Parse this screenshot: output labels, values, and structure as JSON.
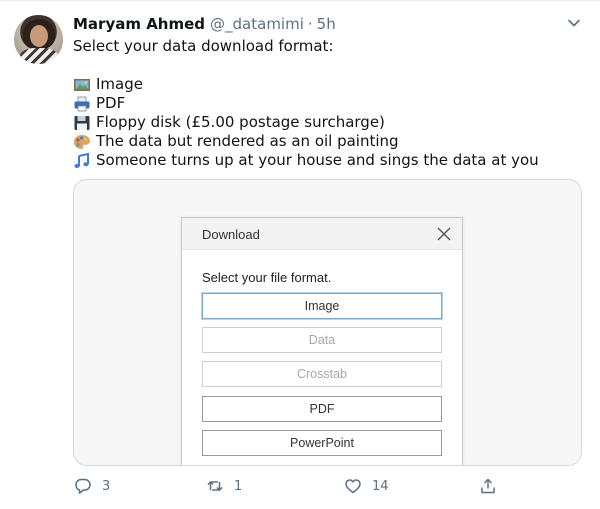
{
  "tweet": {
    "author_name": "Maryam Ahmed",
    "author_handle": "@_datamimi",
    "separator": "·",
    "timestamp": "5h",
    "lines": [
      {
        "text": "Select your data download format:",
        "icon": ""
      },
      {
        "text": "Image",
        "icon": "picture-emoji"
      },
      {
        "text": "PDF",
        "icon": "printer-emoji"
      },
      {
        "text": "Floppy disk (£5.00 postage surcharge)",
        "icon": "floppy-disk-emoji"
      },
      {
        "text": "The data but rendered as an oil painting",
        "icon": "artist-palette-emoji"
      },
      {
        "text": "Someone turns up at your house and sings the data at you",
        "icon": "musical-notes-emoji"
      }
    ]
  },
  "dialog": {
    "title": "Download",
    "prompt": "Select your file format.",
    "options": [
      {
        "label": "Image",
        "state": "selected"
      },
      {
        "label": "Data",
        "state": "disabled"
      },
      {
        "label": "Crosstab",
        "state": "disabled"
      },
      {
        "label": "PDF",
        "state": "enabled"
      },
      {
        "label": "PowerPoint",
        "state": "enabled"
      }
    ]
  },
  "actions": {
    "reply_count": "3",
    "retweet_count": "1",
    "like_count": "14"
  },
  "colors": {
    "text": "#0f1419",
    "muted": "#5b7083",
    "border": "#cfd9de"
  }
}
